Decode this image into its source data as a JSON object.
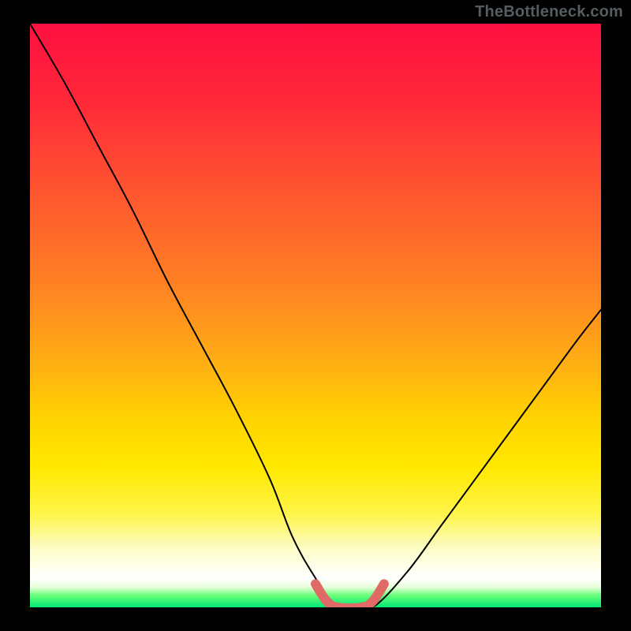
{
  "watermark": "TheBottleneck.com",
  "chart_data": {
    "type": "line",
    "title": "",
    "xlabel": "",
    "ylabel": "",
    "xlim": [
      0,
      100
    ],
    "ylim": [
      0,
      100
    ],
    "grid": false,
    "legend": false,
    "annotations": [],
    "series": [
      {
        "name": "bottleneck-curve",
        "x": [
          0,
          6,
          12,
          18,
          24,
          30,
          36,
          42,
          46,
          50,
          53,
          56,
          60,
          66,
          72,
          78,
          84,
          90,
          96,
          100
        ],
        "values": [
          100,
          90,
          79,
          68,
          56,
          45,
          34,
          22,
          12,
          5,
          1,
          0,
          0,
          6,
          14,
          22,
          30,
          38,
          46,
          51
        ]
      },
      {
        "name": "flat-minimum-marker",
        "x": [
          50,
          52,
          54,
          58,
          60,
          62
        ],
        "values": [
          4,
          1,
          0,
          0,
          1,
          4
        ]
      }
    ],
    "colors": {
      "curve": "#000000",
      "marker": "#e06a66",
      "gradient_top": "#ff1040",
      "gradient_mid": "#ffd400",
      "gradient_bottom": "#00e876"
    }
  }
}
